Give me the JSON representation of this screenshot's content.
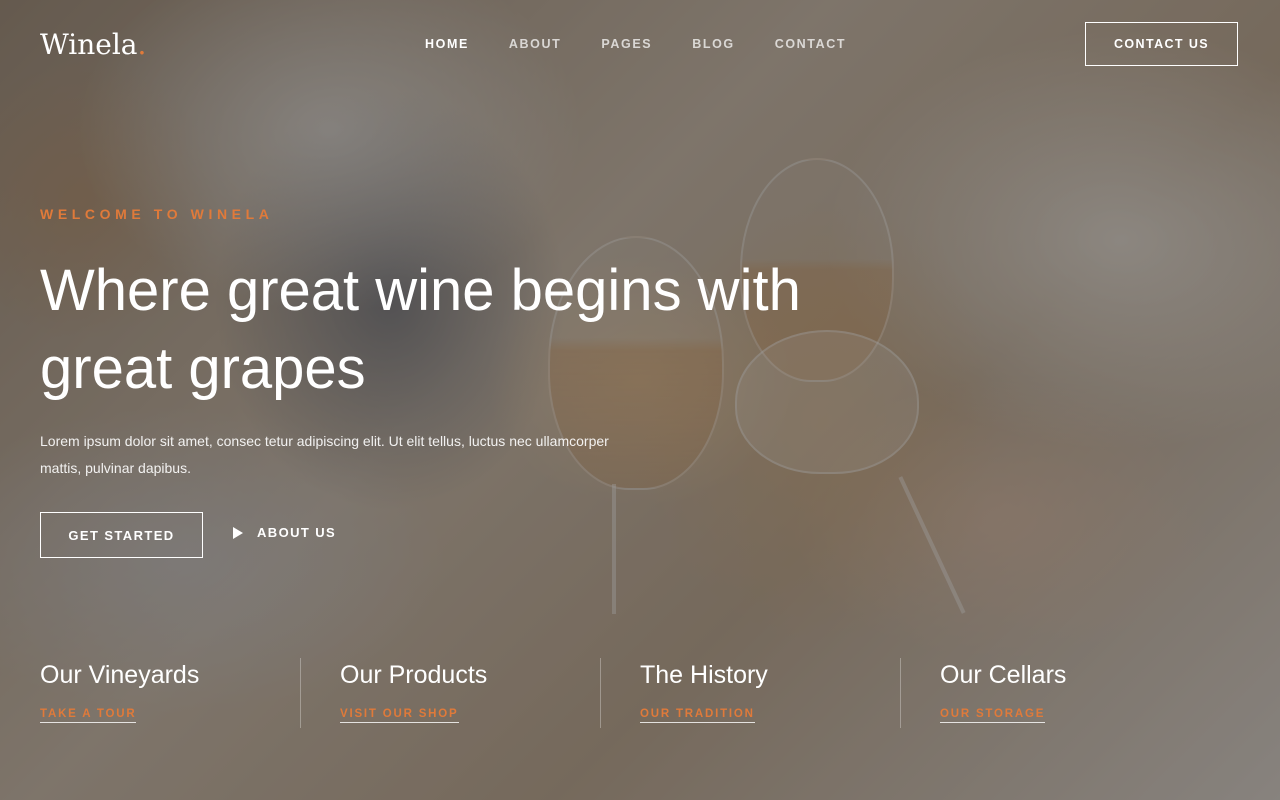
{
  "brand": {
    "name": "Winela",
    "dot": ".",
    "accent_color": "#e07a3a"
  },
  "nav": {
    "items": [
      {
        "label": "HOME",
        "active": true
      },
      {
        "label": "ABOUT",
        "active": false
      },
      {
        "label": "PAGES",
        "active": false
      },
      {
        "label": "BLOG",
        "active": false
      },
      {
        "label": "CONTACT",
        "active": false
      }
    ],
    "cta_label": "CONTACT US"
  },
  "hero": {
    "eyebrow": "WELCOME TO WINELA",
    "title": "Where great wine begins with great grapes",
    "description": "Lorem ipsum dolor sit amet, consec tetur adipiscing elit. Ut elit tellus, luctus nec ullamcorper mattis, pulvinar dapibus.",
    "primary_button": "GET STARTED",
    "secondary_button": "ABOUT US",
    "secondary_icon": "play-icon"
  },
  "features": [
    {
      "title": "Our Vineyards",
      "link": "TAKE A TOUR"
    },
    {
      "title": "Our Products",
      "link": "VISIT OUR SHOP"
    },
    {
      "title": "The History",
      "link": "OUR TRADITION"
    },
    {
      "title": "Our Cellars",
      "link": "OUR STORAGE"
    }
  ]
}
